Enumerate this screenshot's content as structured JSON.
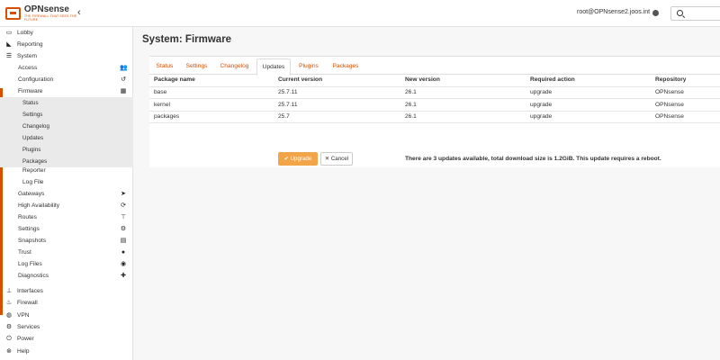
{
  "header": {
    "brand": "OPNsense",
    "tagline": "THE FIREWALL THAT SEES THE FUTURE",
    "user": "root@OPNsense2.joos.int"
  },
  "sidebar": {
    "lobby": "Lobby",
    "reporting": "Reporting",
    "system": "System",
    "access": "Access",
    "configuration": "Configuration",
    "firmware": "Firmware",
    "firmware_items": [
      "Status",
      "Settings",
      "Changelog",
      "Updates",
      "Plugins",
      "Packages"
    ],
    "reporter": "Reporter",
    "logfile": "Log File",
    "gateways": "Gateways",
    "high_availability": "High Availability",
    "routes": "Routes",
    "settings": "Settings",
    "snapshots": "Snapshots",
    "trust": "Trust",
    "log_files": "Log Files",
    "diagnostics": "Diagnostics",
    "interfaces": "Interfaces",
    "firewall": "Firewall",
    "vpn": "VPN",
    "services": "Services",
    "power": "Power",
    "help": "Help"
  },
  "main": {
    "title": "System: Firmware",
    "tabs": [
      "Status",
      "Settings",
      "Changelog",
      "Updates",
      "Plugins",
      "Packages"
    ],
    "active_tab": "Updates",
    "columns": [
      "Package name",
      "Current version",
      "New version",
      "Required action",
      "Repository"
    ],
    "rows": [
      [
        "base",
        "25.7.11",
        "26.1",
        "upgrade",
        "OPNsense"
      ],
      [
        "kernel",
        "25.7.11",
        "26.1",
        "upgrade",
        "OPNsense"
      ],
      [
        "packages",
        "25.7",
        "26.1",
        "upgrade",
        "OPNsense"
      ]
    ],
    "upgrade_label": "Upgrade",
    "cancel_label": "Cancel",
    "update_message": "There are 3 updates available, total download size is 1.2GiB. This update requires a reboot."
  },
  "colors": {
    "accent": "#d94f00",
    "upgrade_button": "#f2a548"
  }
}
